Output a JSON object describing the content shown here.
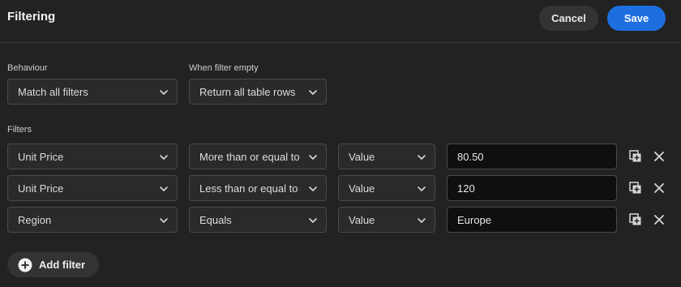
{
  "header": {
    "title": "Filtering",
    "cancel_label": "Cancel",
    "save_label": "Save"
  },
  "behaviour": {
    "label": "Behaviour",
    "value": "Match all filters"
  },
  "when_empty": {
    "label": "When filter empty",
    "value": "Return all table rows"
  },
  "filters_label": "Filters",
  "filters": [
    {
      "field": "Unit Price",
      "operator": "More than or equal to",
      "type": "Value",
      "value": "80.50"
    },
    {
      "field": "Unit Price",
      "operator": "Less than or equal to",
      "type": "Value",
      "value": "120"
    },
    {
      "field": "Region",
      "operator": "Equals",
      "type": "Value",
      "value": "Europe"
    }
  ],
  "add_filter_label": "Add filter",
  "colors": {
    "background": "#222222",
    "accent": "#1d6fe0",
    "input_bg": "#0f0f0f"
  }
}
